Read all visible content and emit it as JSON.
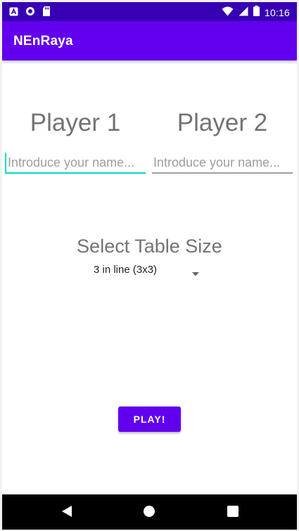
{
  "status_bar": {
    "time": "10:16",
    "colors": {
      "background": "#3700b3"
    },
    "icons": [
      "app-a-icon",
      "circle-app-icon",
      "sd-card-icon",
      "wifi-icon",
      "signal-icon",
      "battery-icon"
    ]
  },
  "app_bar": {
    "title": "NEnRaya",
    "color": "#6200ee"
  },
  "players": [
    {
      "label": "Player 1",
      "placeholder": "Introduce your name...",
      "value": ""
    },
    {
      "label": "Player 2",
      "placeholder": "Introduce your name...",
      "value": ""
    }
  ],
  "table_size": {
    "title": "Select Table Size",
    "selected": "3 in line (3x3)"
  },
  "play_button": {
    "label": "PLAY!",
    "color": "#6200ee"
  },
  "nav_bar": {
    "icons": [
      "back-icon",
      "home-icon",
      "recents-icon"
    ]
  },
  "colors": {
    "focus_underline": "#03dac5",
    "idle_underline": "#9e9e9e"
  }
}
